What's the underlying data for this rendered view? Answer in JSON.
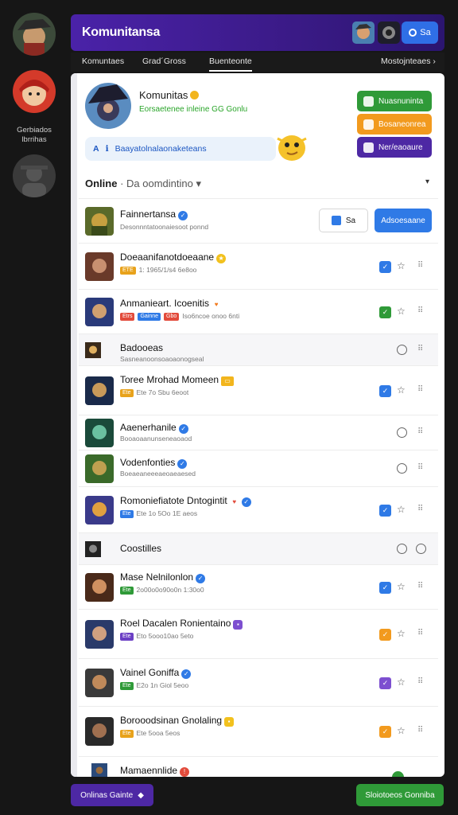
{
  "sidebar": {
    "label": "Gerbiados\nlbrrihas"
  },
  "header": {
    "title": "Komunitansa",
    "button_label": "Sa"
  },
  "tabs": [
    {
      "label": "Komuntaes"
    },
    {
      "label": "Grad´Gross"
    },
    {
      "label": "Buenteonte"
    },
    {
      "label": "Mostojnteaes ›"
    }
  ],
  "profile": {
    "name": "Komunitas",
    "subtitle": "Eorsaetenee inleine GG Gonlu"
  },
  "actions": [
    {
      "label": "Nuasnuninta",
      "color": "#2f9a38"
    },
    {
      "label": "Bosaneonrea",
      "color": "#f29a1e"
    },
    {
      "label": "Ner/eaoaure",
      "color": "#4d28a4"
    }
  ],
  "invite": {
    "icon_text": "A",
    "text": "Baayatolnalaonaketeans"
  },
  "section": {
    "title": "Online",
    "separator": " · ",
    "sub": "Da oomdintino"
  },
  "first_row": {
    "name": "Fainnertansa",
    "sub": "Desonnntatoonaiesoot ponnd",
    "btn_secondary": "Sa",
    "btn_primary": "Adsoesaane"
  },
  "rows": [
    {
      "name": "Doeaanifanotdoeaane",
      "sub": "1: 1965/1/s4 6e8oo",
      "badges": [
        {
          "t": "ETE",
          "c": "#e8a21b"
        }
      ],
      "action_color": "#2f7ae6"
    },
    {
      "name": "Anmanieart. Icoenitis",
      "sub": "Iso6ncoe onoo 6nti",
      "badges": [
        {
          "t": "Etrs",
          "c": "#e24b3b"
        },
        {
          "t": "Gainne",
          "c": "#2f7ae6"
        },
        {
          "t": "Gbo",
          "c": "#e24b3b"
        }
      ],
      "action_color": "#2f9a38"
    },
    {
      "name": "Badooeas",
      "sub": "Sasneanoonsoaoaonogseal",
      "badges": [],
      "action_color": ""
    },
    {
      "name": "Toree Mrohad  Momeen",
      "sub": "Ete 7o Sbu 6eoot",
      "badges": [
        {
          "t": "Ete",
          "c": "#e8a21b"
        }
      ],
      "action_color": "#2f7ae6"
    },
    {
      "name": "Aaenerhanile",
      "sub": "Booaoaanunseneaoaod",
      "badges": [],
      "action_color": ""
    },
    {
      "name": "Vodenfonties",
      "sub": "Boeaeaneeeaeoaeaesed",
      "badges": [],
      "action_color": ""
    },
    {
      "name": "Romoniefiatote Dntogintit",
      "sub": "Ete 1o 5Oo 1E aeos",
      "badges": [
        {
          "t": "Ete",
          "c": "#2f7ae6"
        }
      ],
      "action_color": "#2f7ae6"
    },
    {
      "name": "Coostilles",
      "sub": "",
      "badges": [],
      "action_color": ""
    },
    {
      "name": "Mase Nelnilonlon",
      "sub": "2o00o0o90o0n 1:30o0",
      "badges": [
        {
          "t": "Ete",
          "c": "#2f9a38"
        }
      ],
      "action_color": "#2f7ae6"
    },
    {
      "name": "Roel  Dacalen  Ronientaino",
      "sub": "Eto 5ooo10ao 5eto",
      "badges": [
        {
          "t": "Ete",
          "c": "#6b3fc4"
        }
      ],
      "action_color": "#f29a1e"
    },
    {
      "name": "Vainel  Goniffa",
      "sub": "E2o 1n Giol 5eoo",
      "badges": [
        {
          "t": "Ete",
          "c": "#2f9a38"
        }
      ],
      "action_color": "#7d4fd0"
    },
    {
      "name": "Borooodsinan  Gnolaling",
      "sub": "Ete 5ooa 5eos",
      "badges": [
        {
          "t": "Ete",
          "c": "#e8a21b"
        }
      ],
      "action_color": "#f29a1e"
    },
    {
      "name": "Mamaennlide",
      "sub": "",
      "badges": [],
      "action_color": ""
    }
  ],
  "footer": {
    "left_label": "Onlinas Gainte",
    "right_label": "Sloiotoeos Gonniba"
  }
}
